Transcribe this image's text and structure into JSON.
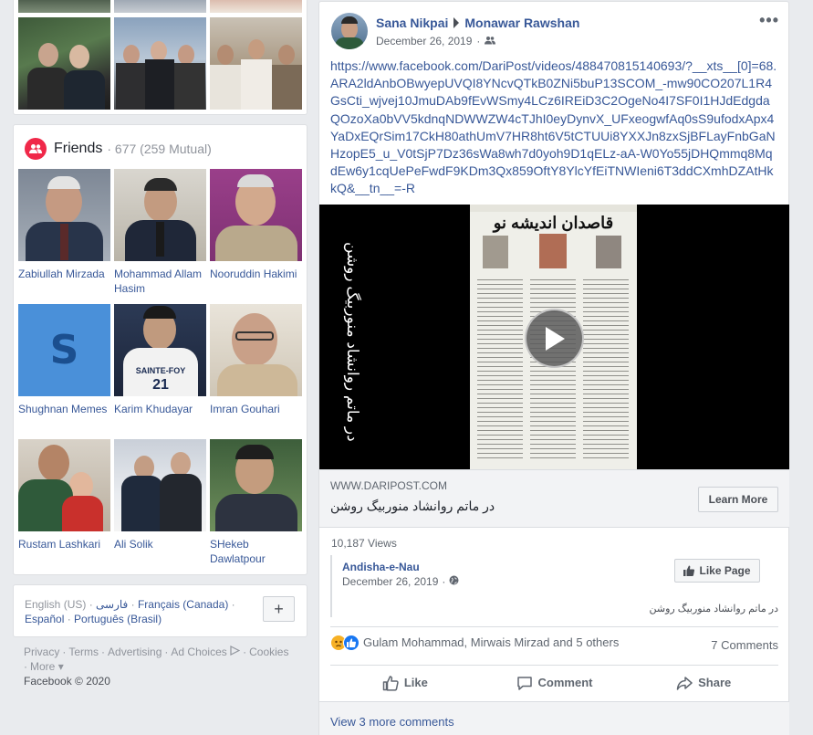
{
  "friends": {
    "title": "Friends",
    "count": "· 677 (259 Mutual)",
    "list": [
      {
        "name": "Zabiullah Mirzada"
      },
      {
        "name": "Mohammad Allam Hasim"
      },
      {
        "name": "Nooruddin Hakimi"
      },
      {
        "name": "Shughnan Memes",
        "tile_letter": "S"
      },
      {
        "name": "Karim Khudayar",
        "jersey_text": "SAINTE-FOY",
        "jersey_number": "21"
      },
      {
        "name": "Imran Gouhari"
      },
      {
        "name": "Rustam Lashkari"
      },
      {
        "name": "Ali Solik"
      },
      {
        "name": "SHekeb Dawlatpour"
      }
    ]
  },
  "languages": {
    "current": "English (US)",
    "options": [
      "فارسی",
      "Français (Canada)",
      "Español",
      "Português (Brasil)"
    ],
    "add_label": "+"
  },
  "footer": {
    "links": [
      "Privacy",
      "Terms",
      "Advertising",
      "Ad Choices",
      "Cookies",
      "More"
    ],
    "more_arrow": "▾",
    "copyright": "Facebook © 2020"
  },
  "post": {
    "author": "Sana Nikpai",
    "target": "Monawar Rawshan",
    "date": "December 26, 2019",
    "privacy_icon": "friends-icon",
    "menu_label": "•••",
    "text": "https://www.facebook.com/DariPost/videos/488470815140693/?__xts__[0]=68.ARA2ldAnbOBwyepUVQI8YNcvQTkB0ZNi5buP13SCOM_-mw90CO207L1R4GsCti_wjvej10JmuDAb9fEvWSmy4LCz6IREiD3C2OgeNo4I7SF0I1HJdEdgdaQOzoXa0bVV5kdnqNDWWZW4cTJhI0eyDynvX_UFxeogwfAq0sS9ufodxApx4YaDxEQrSim17CkH80athUmV7HR8ht6V5tCTUUi8YXXJn8zxSjBFLayFnbGaNHzopE5_u_V0tSjP7Dz36sWa8wh7d0yoh9D1qELz-aA-W0Yo55jDHQmmq8MqdEw6y1cqUePeFwdF9KDm3Qx859OftY8YlcYfEiTNWIeni6T3ddCXmhDZAtHkkQ&__tn__=-R",
    "video": {
      "side_caption": "در ماتم روانشاد منوربیگ روشن",
      "newspaper_title": "قاصدان اندیشه نو"
    },
    "link": {
      "domain": "WWW.DARIPOST.COM",
      "title": "در ماتم روانشاد منوربیگ روشن",
      "button": "Learn More"
    },
    "views": "10,187 Views",
    "page": {
      "name": "Andisha-e-Nau",
      "date": "December 26, 2019",
      "like_button": "Like Page",
      "description": "در ماتم روانشاد منوربیگ روشن"
    },
    "reactions": {
      "names": "Gulam Mohammad, Mirwais Mirzad and 5 others",
      "comments": "7 Comments"
    },
    "actions": {
      "like": "Like",
      "comment": "Comment",
      "share": "Share"
    },
    "more_comments": "View 3 more comments"
  }
}
